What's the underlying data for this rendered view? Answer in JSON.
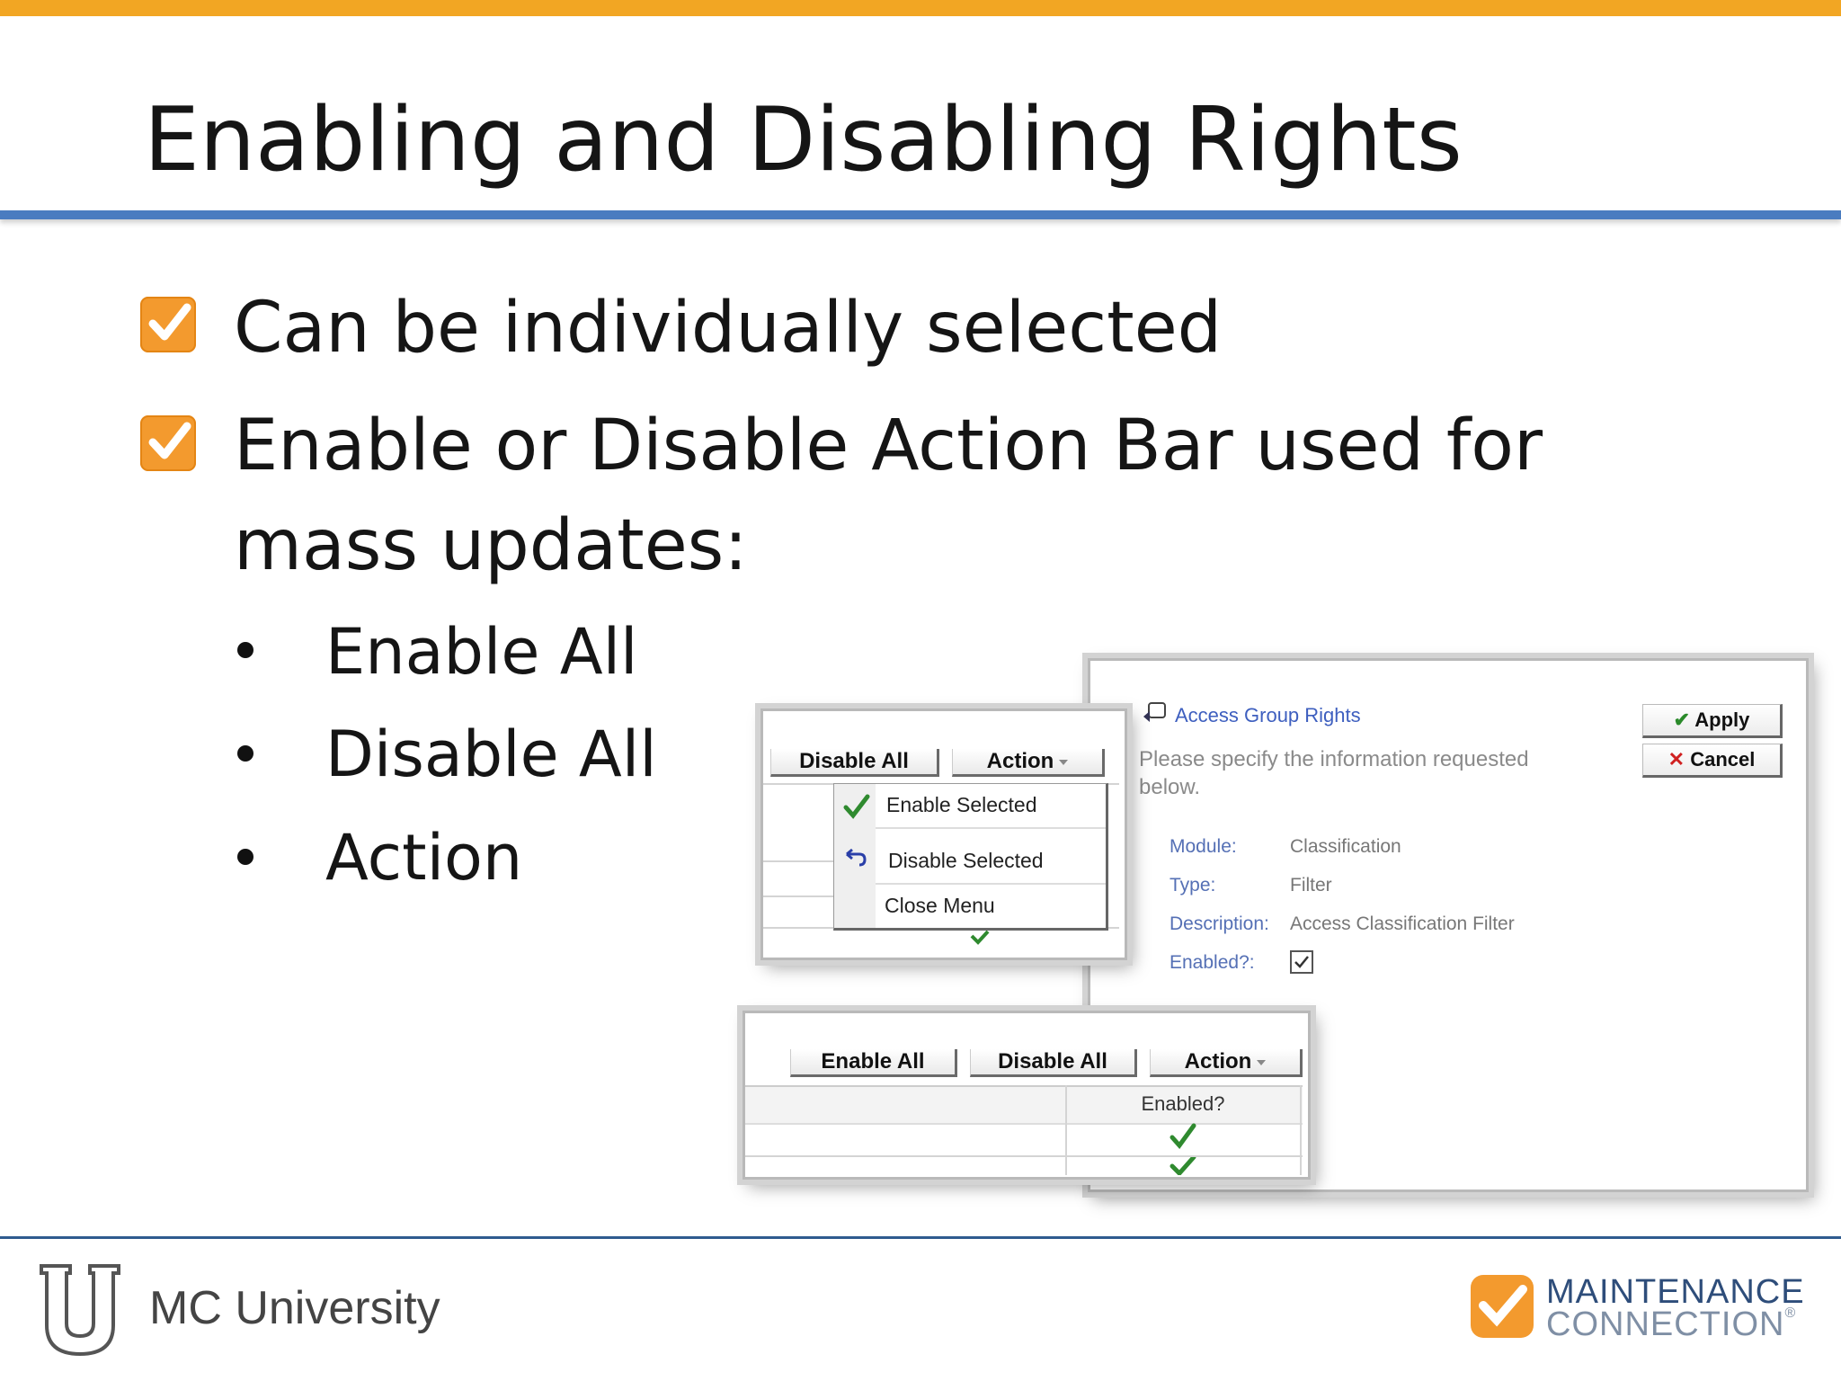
{
  "slide": {
    "title": "Enabling and Disabling Rights",
    "bullets": [
      "Can be individually selected",
      "Enable or Disable Action Bar used for",
      "mass updates:"
    ],
    "sub_bullets": [
      "Enable All",
      "Disable All",
      "Action"
    ]
  },
  "dialog": {
    "title": "Access Group Rights",
    "instructions_line1": "Please specify the information requested",
    "instructions_line2": "below.",
    "apply_label": "Apply",
    "cancel_label": "Cancel",
    "fields": {
      "module_label": "Module:",
      "module_value": "Classification",
      "type_label": "Type:",
      "type_value": "Filter",
      "description_label": "Description:",
      "description_value": "Access Classification Filter",
      "enabled_label": "Enabled?:"
    }
  },
  "action_menu_panel": {
    "disable_all_label": "Disable All",
    "action_label": "Action",
    "menu_items": [
      "Enable Selected",
      "Disable Selected",
      "Close Menu"
    ]
  },
  "action_bar_panel": {
    "enable_all_label": "Enable All",
    "disable_all_label": "Disable All",
    "action_label": "Action",
    "column_header": "Enabled?"
  },
  "footer": {
    "university_label": "MC University",
    "brand_line1": "MAINTENANCE",
    "brand_line2": "CONNECTION",
    "brand_mark": "®"
  },
  "colors": {
    "accent_orange": "#f2a623",
    "title_rule_blue": "#4a7cc0",
    "check_orange": "#f39a2e",
    "link_blue": "#5570b5",
    "check_green": "#2f8a2f"
  }
}
